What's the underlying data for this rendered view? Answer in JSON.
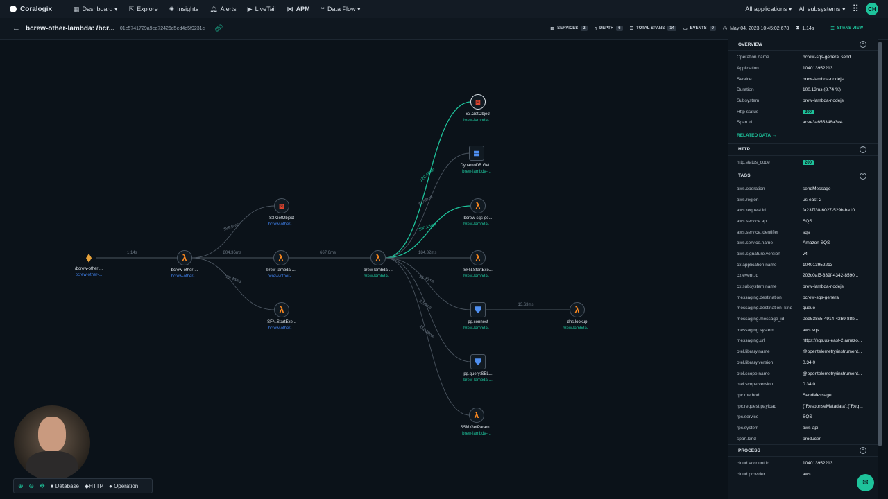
{
  "nav": {
    "brand": "Coralogix",
    "items": [
      {
        "label": "Dashboard ▾",
        "icon": "dashboard-icon"
      },
      {
        "label": "Explore",
        "icon": "explore-icon"
      },
      {
        "label": "Insights",
        "icon": "insights-icon"
      },
      {
        "label": "Alerts",
        "icon": "bell-icon"
      },
      {
        "label": "LiveTail",
        "icon": "play-icon"
      },
      {
        "label": "APM",
        "icon": "apm-icon"
      },
      {
        "label": "Data Flow ▾",
        "icon": "dataflow-icon"
      }
    ],
    "apps": "All applications",
    "subsystems": "All subsystems",
    "user": "CH"
  },
  "trace": {
    "title": "bcrew-other-lambda: /bcr...",
    "id": "01e5741729a9ea72426d5ed4e5f9231c"
  },
  "stats": {
    "services_label": "SERVICES",
    "services": "2",
    "depth_label": "DEPTH",
    "depth": "6",
    "spans_label": "TOTAL SPANS",
    "spans": "14",
    "events_label": "EVENTS",
    "events": "0",
    "date": "May 04, 2023 10:45:02.678",
    "duration": "1.14s",
    "view": "SPANS VIEW"
  },
  "graph": {
    "nodes": [
      {
        "label": "/bcrew-other ...",
        "sub": "bcrew-other-...",
        "icon": "api-gateway-icon",
        "color": "blue"
      },
      {
        "label": "bcrew-other-...",
        "sub": "bcrew-other-...",
        "icon": "lambda-icon",
        "color": "blue"
      },
      {
        "label": "S3.GetObject",
        "sub": "bcrew-other-...",
        "icon": "s3-icon",
        "color": "blue"
      },
      {
        "label": "brew-lambda-...",
        "sub": "bcrew-other-...",
        "icon": "lambda-icon",
        "color": "blue"
      },
      {
        "label": "SFN.StartExe...",
        "sub": "bcrew-other-...",
        "icon": "lambda-icon",
        "color": "blue"
      },
      {
        "label": "brew-lambda-...",
        "sub": "brew-lambda-...",
        "icon": "lambda-icon",
        "color": "green"
      },
      {
        "label": "S3.GetObject",
        "sub": "brew-lambda-...",
        "icon": "s3-icon",
        "color": "green"
      },
      {
        "label": "DynamoDB.Get...",
        "sub": "brew-lambda-...",
        "icon": "dynamodb-icon",
        "color": "green"
      },
      {
        "label": "bcrew-sqs-ge...",
        "sub": "brew-lambda-...",
        "icon": "lambda-icon",
        "color": "green"
      },
      {
        "label": "SFN.StartExe...",
        "sub": "brew-lambda-...",
        "icon": "lambda-icon",
        "color": "green"
      },
      {
        "label": "pg.connect",
        "sub": "brew-lambda-...",
        "icon": "postgres-icon",
        "color": "green"
      },
      {
        "label": "pg.query:SEL...",
        "sub": "brew-lambda-...",
        "icon": "postgres-icon",
        "color": "green"
      },
      {
        "label": "SSM.GetParam...",
        "sub": "brew-lambda-...",
        "icon": "lambda-icon",
        "color": "green"
      },
      {
        "label": "dns.lookup",
        "sub": "brew-lambda-...",
        "icon": "lambda-icon",
        "color": "green"
      }
    ],
    "edges": [
      {
        "from": 0,
        "to": 1,
        "label": "1.14s"
      },
      {
        "from": 1,
        "to": 2,
        "label": "199.6ms"
      },
      {
        "from": 1,
        "to": 3,
        "label": "804.36ms"
      },
      {
        "from": 1,
        "to": 4,
        "label": "139.43ms"
      },
      {
        "from": 3,
        "to": 5,
        "label": "667.6ms"
      },
      {
        "from": 5,
        "to": 6,
        "label": "120.45ms",
        "highlight": true
      },
      {
        "from": 5,
        "to": 7,
        "label": "71.56ms"
      },
      {
        "from": 5,
        "to": 8,
        "label": "100.13ms",
        "highlight": true
      },
      {
        "from": 5,
        "to": 9,
        "label": "184.82ms"
      },
      {
        "from": 5,
        "to": 10,
        "label": "33.96ms"
      },
      {
        "from": 5,
        "to": 11,
        "label": "2.56ms"
      },
      {
        "from": 5,
        "to": 12,
        "label": "111.38ms"
      },
      {
        "from": 10,
        "to": 13,
        "label": "13.63ms"
      }
    ]
  },
  "legend": {
    "database": "Database",
    "http": "HTTP",
    "operation": "Operation"
  },
  "panel": {
    "overview_title": "OVERVIEW",
    "overview": [
      {
        "k": "Operation name",
        "v": "bcrew-sqs-general send"
      },
      {
        "k": "Application",
        "v": "104013952213"
      },
      {
        "k": "Service",
        "v": "brew-lambda-nodejs"
      },
      {
        "k": "Duration",
        "v": "100.13ms (8.74 %)"
      },
      {
        "k": "Subsystem",
        "v": "brew-lambda-nodejs"
      },
      {
        "k": "Http status",
        "v": "200",
        "pill": true
      },
      {
        "k": "Span id",
        "v": "acee3a655348a3e4"
      }
    ],
    "related": "RELATED DATA →",
    "http_title": "HTTP",
    "http": [
      {
        "k": "http.status_code",
        "v": "200",
        "pill": true
      }
    ],
    "tags_title": "TAGS",
    "tags": [
      {
        "k": "aws.operation",
        "v": "sendMessage"
      },
      {
        "k": "aws.region",
        "v": "us-east-2"
      },
      {
        "k": "aws.request.id",
        "v": "fa237f30-6027-529b-ba10..."
      },
      {
        "k": "aws.service.api",
        "v": "SQS"
      },
      {
        "k": "aws.service.identifier",
        "v": "sqs"
      },
      {
        "k": "aws.service.name",
        "v": "Amazon SQS"
      },
      {
        "k": "aws.signature.version",
        "v": "v4"
      },
      {
        "k": "cx.application.name",
        "v": "104013952213"
      },
      {
        "k": "cx.event.id",
        "v": "203c0af5-339f-4342-8590..."
      },
      {
        "k": "cx.subsystem.name",
        "v": "brew-lambda-nodejs"
      },
      {
        "k": "messaging.destination",
        "v": "bcrew-sqs-general"
      },
      {
        "k": "messaging.destination_kind",
        "v": "queue"
      },
      {
        "k": "messaging.message_id",
        "v": "0ed538c5-4914-42b9-88b..."
      },
      {
        "k": "messaging.system",
        "v": "aws.sqs"
      },
      {
        "k": "messaging.url",
        "v": "https://sqs.us-east-2.amazo..."
      },
      {
        "k": "otel.library.name",
        "v": "@opentelemetry/instrument..."
      },
      {
        "k": "otel.library.version",
        "v": "0.34.0"
      },
      {
        "k": "otel.scope.name",
        "v": "@opentelemetry/instrument..."
      },
      {
        "k": "otel.scope.version",
        "v": "0.34.0"
      },
      {
        "k": "rpc.method",
        "v": "SendMessage"
      },
      {
        "k": "rpc.request.payload",
        "v": "{\"ResponseMetadata\":{\"Req..."
      },
      {
        "k": "rpc.service",
        "v": "SQS"
      },
      {
        "k": "rpc.system",
        "v": "aws-api"
      },
      {
        "k": "span.kind",
        "v": "producer"
      }
    ],
    "process_title": "PROCESS",
    "process": [
      {
        "k": "cloud.account.id",
        "v": "104013952213"
      },
      {
        "k": "cloud.provider",
        "v": "aws"
      }
    ]
  }
}
